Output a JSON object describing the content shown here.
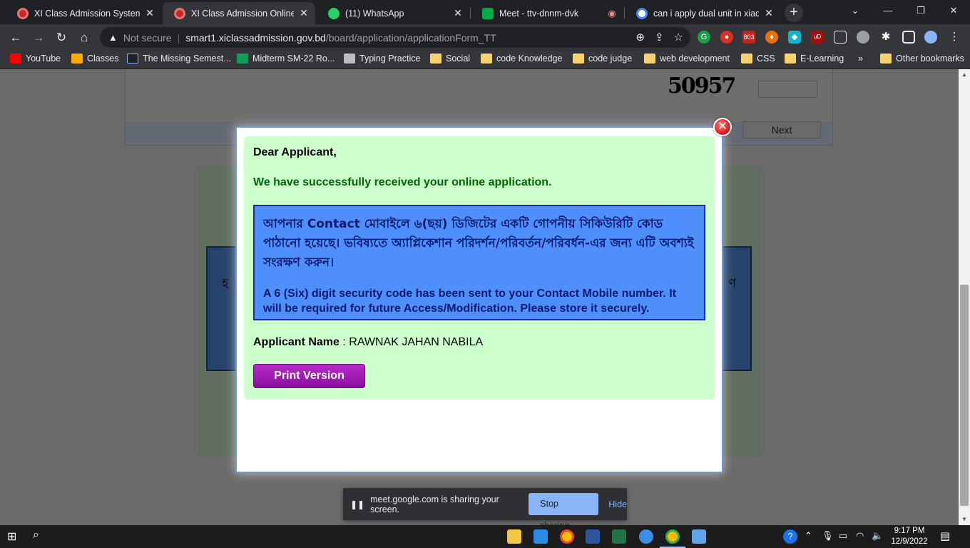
{
  "tabs": [
    {
      "title": "XI Class Admission System",
      "active": false
    },
    {
      "title": "XI Class Admission Online Ap",
      "active": true
    },
    {
      "title": "(11) WhatsApp",
      "active": false
    },
    {
      "title": "Meet - ttv-dnnm-dvk",
      "active": false
    },
    {
      "title": "can i apply dual unit in xiadm",
      "active": false
    }
  ],
  "toolbar": {
    "not_secure": "Not secure",
    "url_host": "smart1.xiclassadmission.gov.bd",
    "url_path": "/board/application/applicationForm_TT",
    "ext_badge": "803"
  },
  "bookmarks": [
    {
      "label": "YouTube"
    },
    {
      "label": "Classes"
    },
    {
      "label": "The Missing Semest..."
    },
    {
      "label": "Midterm SM-22 Ro..."
    },
    {
      "label": "Typing Practice"
    },
    {
      "label": "Social"
    },
    {
      "label": "code Knowledge"
    },
    {
      "label": "code judge"
    },
    {
      "label": "web development"
    },
    {
      "label": "CSS"
    },
    {
      "label": "E-Learning"
    },
    {
      "label": "Other bookmarks"
    }
  ],
  "page": {
    "captcha_code": "50957",
    "next_label": "Next",
    "bg_left": "হ",
    "bg_right": "ণ"
  },
  "modal": {
    "greeting": "Dear Applicant,",
    "success": "We have successfully received your online application.",
    "bangla_notice": "আপনার Contact মোবাইলে ৬(ছয়) ডিজিটের একটি গোপনীয় সিকিউরিটি কোড পাঠানো হয়েছে। ভবিষ্যতে অ্যাপ্লিকেশান পরিদর্শন/পরিবর্তন/পরিবর্ধন-এর জন্য এটি অবশ্যই সংরক্ষণ করুন।",
    "english_notice": "A 6 (Six) digit security code has been sent to your Contact Mobile number. It will be required for future Access/Modification. Please store it securely.",
    "applicant_label": "Applicant Name",
    "applicant_sep": " : ",
    "applicant_name": "RAWNAK JAHAN NABILA",
    "print_label": "Print Version"
  },
  "sharebar": {
    "message": "meet.google.com is sharing your screen.",
    "stop_label": "Stop sharing",
    "hide_label": "Hide"
  },
  "taskbar": {
    "time": "9:17 PM",
    "date": "12/9/2022"
  }
}
